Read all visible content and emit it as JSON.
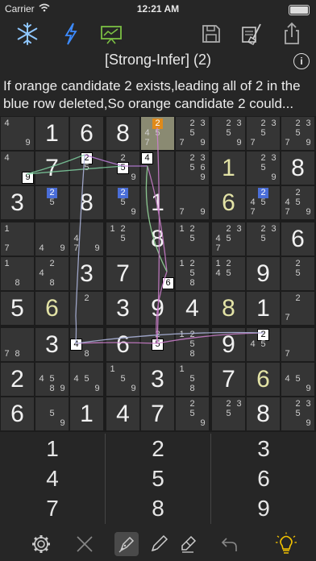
{
  "status": {
    "carrier": "Carrier",
    "time": "12:21 AM"
  },
  "toolbar": {
    "icons": [
      "snowflake-icon",
      "lightning-icon",
      "presentation-icon",
      "save-icon",
      "clear-icon",
      "share-icon"
    ]
  },
  "header": {
    "title": "[Strong-Infer] (2)",
    "info": "i"
  },
  "hint": {
    "text": "If orange candidate 2 exists,leading all of 2 in the blue row deleted,So orange candidate 2 could..."
  },
  "board": {
    "rows": [
      [
        {
          "c": [
            "4",
            "",
            "9"
          ]
        },
        {
          "v": "1"
        },
        {
          "v": "6"
        },
        {
          "v": "8"
        },
        {
          "sel": true,
          "c": [
            "2",
            "45",
            "7"
          ],
          "hl": {
            "2": "orange"
          }
        },
        {
          "c": [
            "2 3",
            "5",
            "7 9"
          ]
        },
        {
          "c": [
            "2 3",
            "5",
            "9"
          ]
        },
        {
          "c": [
            "2 3",
            "5",
            "7"
          ]
        },
        {
          "c": [
            "2 3",
            "5",
            "7 9"
          ]
        }
      ],
      [
        {
          "c": [
            "4",
            "",
            "9"
          ],
          "box": {
            "9": "9"
          }
        },
        {
          "v": "7"
        },
        {
          "c": [
            "2",
            "5",
            ""
          ],
          "box": {
            "2": "2"
          }
        },
        {
          "c": [
            "2",
            "5",
            "9"
          ],
          "box": {
            "5": "5"
          }
        },
        {
          "c": [
            "4",
            "",
            ""
          ],
          "box": {
            "4": "4"
          }
        },
        {
          "c": [
            "2 3",
            "5 6",
            "9"
          ]
        },
        {
          "v": "1",
          "user": true
        },
        {
          "c": [
            "2 3",
            "5",
            "9"
          ]
        },
        {
          "v": "8"
        }
      ],
      [
        {
          "v": "3"
        },
        {
          "c": [
            "2",
            "5",
            ""
          ],
          "hl": {
            "2": "blue"
          }
        },
        {
          "v": "8"
        },
        {
          "c": [
            "2",
            "5",
            "9"
          ],
          "hl": {
            "2": "blue"
          }
        },
        {
          "v": "1"
        },
        {
          "c": [
            "",
            "",
            "7 9"
          ]
        },
        {
          "v": "6",
          "user": true
        },
        {
          "c": [
            "2",
            "45",
            "7"
          ],
          "hl": {
            "2": "blue"
          }
        },
        {
          "c": [
            "2",
            "45",
            "7 9"
          ]
        }
      ],
      [
        {
          "c": [
            "1",
            "",
            "7"
          ]
        },
        {
          "c": [
            "",
            "",
            "4 9"
          ]
        },
        {
          "c": [
            "",
            "4",
            "7 9"
          ]
        },
        {
          "c": [
            "1 2",
            "5",
            ""
          ]
        },
        {
          "v": "8"
        },
        {
          "c": [
            "1 2",
            "5",
            ""
          ]
        },
        {
          "c": [
            "2 3",
            "45",
            "7"
          ]
        },
        {
          "c": [
            "2 3",
            "5",
            ""
          ]
        },
        {
          "v": "6"
        }
      ],
      [
        {
          "c": [
            "1",
            "",
            "8"
          ]
        },
        {
          "c": [
            "2",
            "4",
            "8"
          ]
        },
        {
          "v": "3"
        },
        {
          "v": "7"
        },
        {
          "c": [
            "",
            "",
            "6"
          ],
          "box": {
            "6": "6"
          }
        },
        {
          "c": [
            "1 2",
            "5",
            "8"
          ]
        },
        {
          "c": [
            "1 2",
            "45",
            ""
          ]
        },
        {
          "v": "9"
        },
        {
          "c": [
            "2",
            "5",
            ""
          ]
        }
      ],
      [
        {
          "v": "5"
        },
        {
          "v": "6",
          "user": true
        },
        {
          "c": [
            "2",
            "",
            ""
          ]
        },
        {
          "v": "3"
        },
        {
          "v": "9"
        },
        {
          "v": "4"
        },
        {
          "v": "8",
          "user": true
        },
        {
          "v": "1"
        },
        {
          "c": [
            "2",
            "",
            "7"
          ]
        }
      ],
      [
        {
          "c": [
            "",
            "",
            "7 8"
          ]
        },
        {
          "v": "3"
        },
        {
          "c": [
            "",
            "4",
            "8"
          ],
          "box": {
            "4": "4"
          }
        },
        {
          "v": "6"
        },
        {
          "c": [
            "2",
            "5",
            ""
          ],
          "box": {
            "5": "5"
          }
        },
        {
          "c": [
            "1 2",
            "5",
            "8"
          ]
        },
        {
          "v": "9"
        },
        {
          "c": [
            "2",
            "45",
            ""
          ],
          "box": {
            "2": "2"
          }
        },
        {
          "c": [
            "",
            "",
            "7"
          ]
        }
      ],
      [
        {
          "v": "2"
        },
        {
          "c": [
            "",
            "45",
            "8 9"
          ]
        },
        {
          "c": [
            "",
            "45",
            "9"
          ]
        },
        {
          "c": [
            "1",
            "5",
            "9"
          ]
        },
        {
          "v": "3"
        },
        {
          "c": [
            "1",
            "5",
            "8"
          ]
        },
        {
          "v": "7"
        },
        {
          "v": "6",
          "user": true
        },
        {
          "c": [
            "",
            "45",
            "9"
          ]
        }
      ],
      [
        {
          "v": "6"
        },
        {
          "c": [
            "",
            "5",
            "9"
          ]
        },
        {
          "v": "1"
        },
        {
          "v": "4"
        },
        {
          "v": "7"
        },
        {
          "c": [
            "2",
            "5",
            "9"
          ]
        },
        {
          "c": [
            "2 3",
            "5",
            ""
          ]
        },
        {
          "v": "8"
        },
        {
          "c": [
            "2 3",
            "5",
            "9"
          ]
        }
      ]
    ]
  },
  "keypad": {
    "keys": [
      "1",
      "2",
      "3",
      "4",
      "5",
      "6",
      "7",
      "8",
      "9"
    ]
  },
  "bottombar": {
    "icons": [
      "gear-icon",
      "close-icon",
      "pen-icon",
      "pencil-icon",
      "eraser-icon",
      "undo-icon",
      "lightbulb-icon"
    ]
  },
  "colors": {
    "orange": "#e08a1a",
    "blue": "#4a6ed8",
    "bulb": "#f2c200"
  }
}
